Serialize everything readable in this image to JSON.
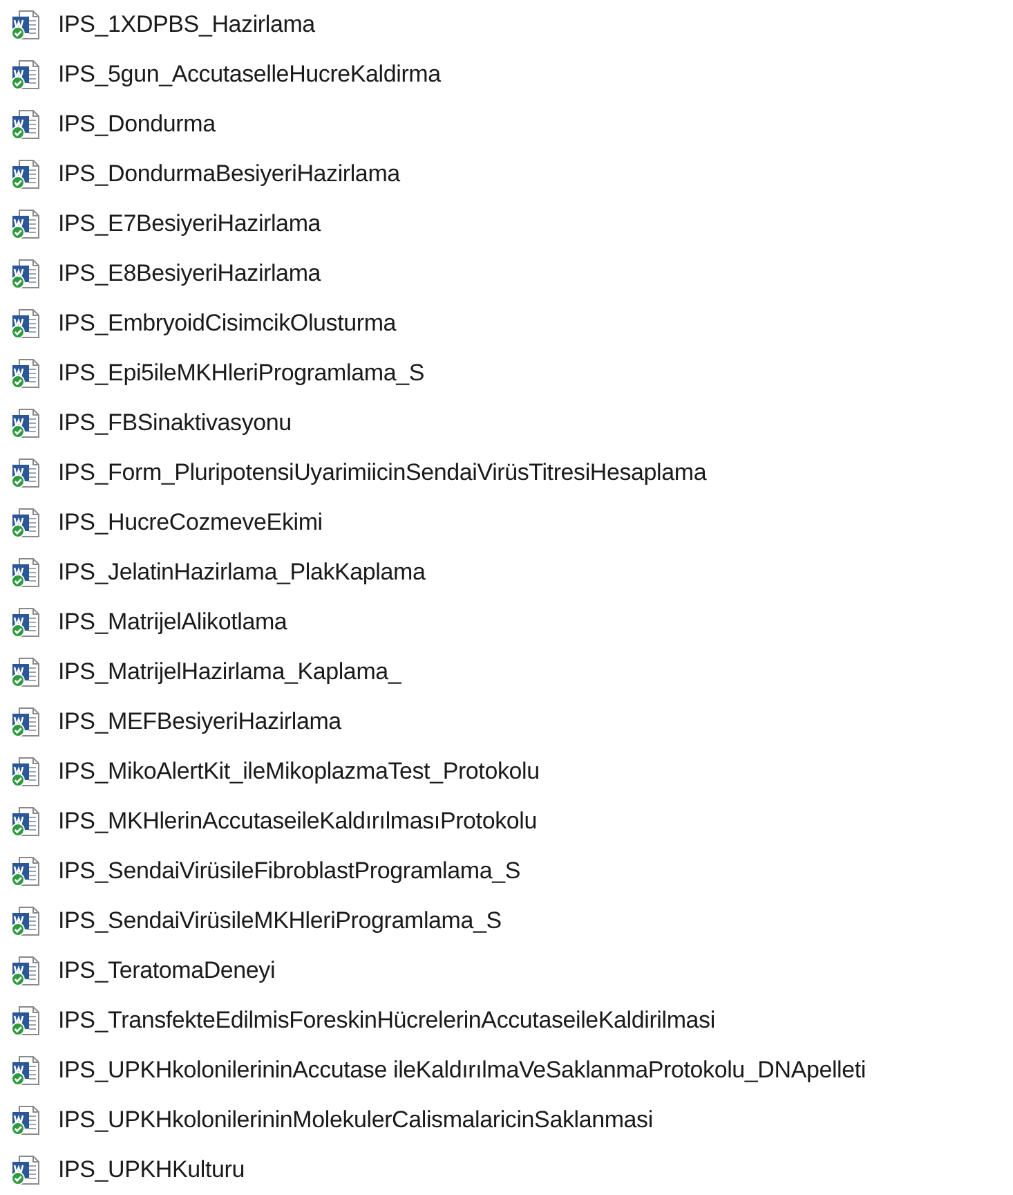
{
  "files": [
    {
      "name": "IPS_1XDPBS_Hazirlama"
    },
    {
      "name": "IPS_5gun_AccutaselleHucreKaldirma"
    },
    {
      "name": "IPS_Dondurma"
    },
    {
      "name": "IPS_DondurmaBesiyeriHazirlama"
    },
    {
      "name": "IPS_E7BesiyeriHazirlama"
    },
    {
      "name": "IPS_E8BesiyeriHazirlama"
    },
    {
      "name": "IPS_EmbryoidCisimcikOlusturma"
    },
    {
      "name": "IPS_Epi5ileMKHleriProgramlama_S"
    },
    {
      "name": "IPS_FBSinaktivasyonu"
    },
    {
      "name": "IPS_Form_PluripotensiUyarimiicinSendaiVirüsTitresiHesaplama"
    },
    {
      "name": "IPS_HucreCozmeveEkimi"
    },
    {
      "name": "IPS_JelatinHazirlama_PlakKaplama"
    },
    {
      "name": "IPS_MatrijelAlikotlama"
    },
    {
      "name": "IPS_MatrijelHazirlama_Kaplama_"
    },
    {
      "name": "IPS_MEFBesiyeriHazirlama"
    },
    {
      "name": "IPS_MikoAlertKit_ileMikoplazmaTest_Protokolu"
    },
    {
      "name": "IPS_MKHlerinAccutaseileKaldırılmasıProtokolu"
    },
    {
      "name": "IPS_SendaiVirüsileFibroblastProgramlama_S"
    },
    {
      "name": "IPS_SendaiVirüsileMKHleriProgramlama_S"
    },
    {
      "name": "IPS_TeratomaDeneyi"
    },
    {
      "name": "IPS_TransfekteEdilmisForeskinHücrelerinAccutaseileKaldirilmasi"
    },
    {
      "name": "IPS_UPKHkolonilerininAccutase ileKaldırılmaVeSaklanmaProtokolu_DNApelleti"
    },
    {
      "name": "IPS_UPKHkolonilerininMolekulerCalismalaricinSaklanmasi"
    },
    {
      "name": "IPS_UPKHKulturu"
    }
  ]
}
